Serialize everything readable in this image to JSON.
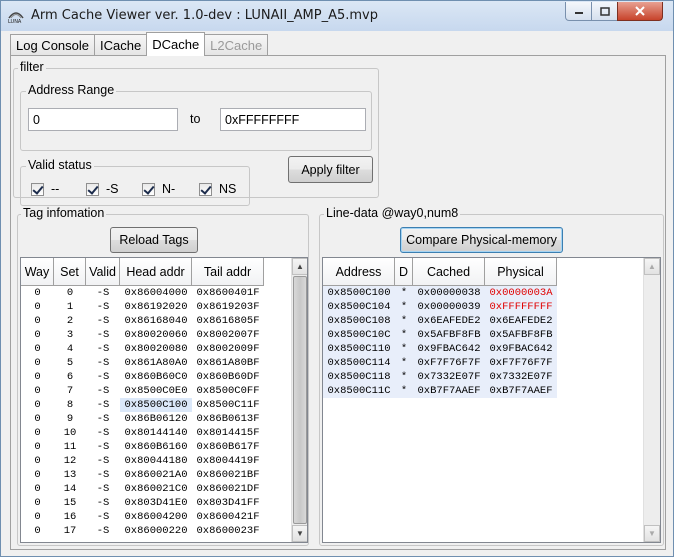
{
  "window": {
    "title": "Arm Cache Viewer ver. 1.0-dev : LUNAII_AMP_A5.mvp"
  },
  "tabs": [
    {
      "label": "Log Console",
      "state": "normal"
    },
    {
      "label": "ICache",
      "state": "normal"
    },
    {
      "label": "DCache",
      "state": "active"
    },
    {
      "label": "L2Cache",
      "state": "disabled"
    }
  ],
  "filter": {
    "group_label": "filter",
    "address_range": {
      "label": "Address Range",
      "from_value": "0",
      "to_label": "to",
      "to_value": "0xFFFFFFFF"
    },
    "valid_status": {
      "label": "Valid status",
      "options": [
        {
          "label": "--",
          "checked": true
        },
        {
          "label": "-S",
          "checked": true
        },
        {
          "label": "N-",
          "checked": true
        },
        {
          "label": "NS",
          "checked": true
        }
      ]
    },
    "apply_label": "Apply filter"
  },
  "tag_info": {
    "group_label": "Tag infomation",
    "reload_label": "Reload Tags",
    "columns": [
      "Way",
      "Set",
      "Valid",
      "Head addr",
      "Tail addr"
    ],
    "selected_row": 8,
    "rows": [
      [
        "0",
        "0",
        "-S",
        "0x86004000",
        "0x8600401F"
      ],
      [
        "0",
        "1",
        "-S",
        "0x86192020",
        "0x8619203F"
      ],
      [
        "0",
        "2",
        "-S",
        "0x86168040",
        "0x8616805F"
      ],
      [
        "0",
        "3",
        "-S",
        "0x80020060",
        "0x8002007F"
      ],
      [
        "0",
        "4",
        "-S",
        "0x80020080",
        "0x8002009F"
      ],
      [
        "0",
        "5",
        "-S",
        "0x861A80A0",
        "0x861A80BF"
      ],
      [
        "0",
        "6",
        "-S",
        "0x860B60C0",
        "0x860B60DF"
      ],
      [
        "0",
        "7",
        "-S",
        "0x8500C0E0",
        "0x8500C0FF"
      ],
      [
        "0",
        "8",
        "-S",
        "0x8500C100",
        "0x8500C11F"
      ],
      [
        "0",
        "9",
        "-S",
        "0x86B06120",
        "0x86B0613F"
      ],
      [
        "0",
        "10",
        "-S",
        "0x80144140",
        "0x8014415F"
      ],
      [
        "0",
        "11",
        "-S",
        "0x860B6160",
        "0x860B617F"
      ],
      [
        "0",
        "12",
        "-S",
        "0x80044180",
        "0x8004419F"
      ],
      [
        "0",
        "13",
        "-S",
        "0x860021A0",
        "0x860021BF"
      ],
      [
        "0",
        "14",
        "-S",
        "0x860021C0",
        "0x860021DF"
      ],
      [
        "0",
        "15",
        "-S",
        "0x803D41E0",
        "0x803D41FF"
      ],
      [
        "0",
        "16",
        "-S",
        "0x86004200",
        "0x8600421F"
      ],
      [
        "0",
        "17",
        "-S",
        "0x86000220",
        "0x8600023F"
      ]
    ]
  },
  "line_data": {
    "group_label": "Line-data @way0,num8",
    "compare_label": "Compare Physical-memory",
    "columns": [
      "Address",
      "D",
      "Cached",
      "Physical"
    ],
    "mismatch_color": "#e00000",
    "rows": [
      {
        "cells": [
          "0x8500C100",
          "*",
          "0x00000038",
          "0x0000003A"
        ],
        "mismatch": true
      },
      {
        "cells": [
          "0x8500C104",
          "*",
          "0x00000039",
          "0xFFFFFFFF"
        ],
        "mismatch": true
      },
      {
        "cells": [
          "0x8500C108",
          "*",
          "0x6EAFEDE2",
          "0x6EAFEDE2"
        ],
        "mismatch": false
      },
      {
        "cells": [
          "0x8500C10C",
          "*",
          "0x5AFBF8FB",
          "0x5AFBF8FB"
        ],
        "mismatch": false
      },
      {
        "cells": [
          "0x8500C110",
          "*",
          "0x9FBAC642",
          "0x9FBAC642"
        ],
        "mismatch": false
      },
      {
        "cells": [
          "0x8500C114",
          "*",
          "0xF7F76F7F",
          "0xF7F76F7F"
        ],
        "mismatch": false
      },
      {
        "cells": [
          "0x8500C118",
          "*",
          "0x7332E07F",
          "0x7332E07F"
        ],
        "mismatch": false
      },
      {
        "cells": [
          "0x8500C11C",
          "*",
          "0xB7F7AAEF",
          "0xB7F7AAEF"
        ],
        "mismatch": false
      }
    ]
  },
  "icons": {
    "app": "luna-logo-icon",
    "minimize": "minimize-icon",
    "maximize": "maximize-icon",
    "close": "close-icon",
    "scroll_up": "scroll-up-arrow-icon",
    "scroll_down": "scroll-down-arrow-icon"
  }
}
